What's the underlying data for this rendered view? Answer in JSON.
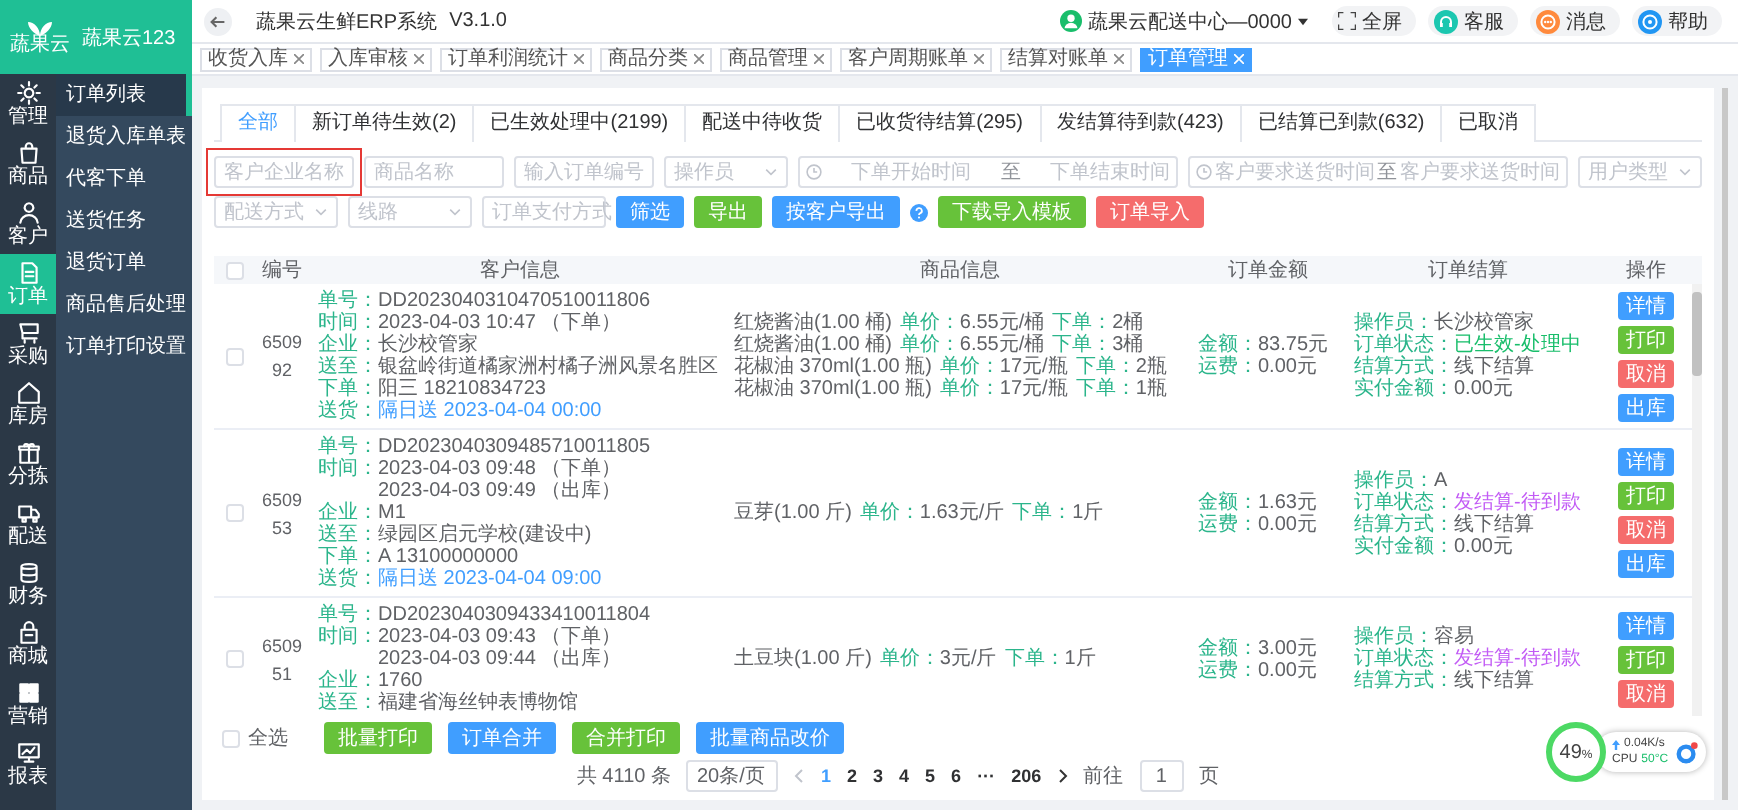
{
  "app": {
    "logo_text": "蔬果云",
    "brand": "蔬果云123"
  },
  "rail": [
    {
      "label": "管理",
      "selected": false
    },
    {
      "label": "商品",
      "selected": false
    },
    {
      "label": "客户",
      "selected": false
    },
    {
      "label": "订单",
      "selected": true
    },
    {
      "label": "采购",
      "selected": false
    },
    {
      "label": "库房",
      "selected": false
    },
    {
      "label": "分拣",
      "selected": false
    },
    {
      "label": "配送",
      "selected": false
    },
    {
      "label": "财务",
      "selected": false
    },
    {
      "label": "商城",
      "selected": false
    },
    {
      "label": "营销",
      "selected": false
    },
    {
      "label": "报表",
      "selected": false
    }
  ],
  "submenu": [
    {
      "label": "订单列表",
      "selected": true
    },
    {
      "label": "退货入库单表",
      "selected": false
    },
    {
      "label": "代客下单",
      "selected": false
    },
    {
      "label": "送货任务",
      "selected": false
    },
    {
      "label": "退货订单",
      "selected": false
    },
    {
      "label": "商品售后处理",
      "selected": false
    },
    {
      "label": "订单打印设置",
      "selected": false
    }
  ],
  "header": {
    "title": "蔬果云生鲜ERP系统",
    "version": "V3.1.0",
    "user": "蔬果云配送中心—0000",
    "buttons": [
      {
        "label": "全屏",
        "kind": "fullscreen"
      },
      {
        "label": "客服",
        "kind": "service"
      },
      {
        "label": "消息",
        "kind": "message"
      },
      {
        "label": "帮助",
        "kind": "help"
      }
    ]
  },
  "tags": [
    {
      "label": "收货入库",
      "selected": false
    },
    {
      "label": "入库审核",
      "selected": false
    },
    {
      "label": "订单利润统计",
      "selected": false
    },
    {
      "label": "商品分类",
      "selected": false
    },
    {
      "label": "商品管理",
      "selected": false
    },
    {
      "label": "客户周期账单",
      "selected": false
    },
    {
      "label": "结算对账单",
      "selected": false
    },
    {
      "label": "订单管理",
      "selected": true
    }
  ],
  "status_tabs": [
    {
      "label": "全部",
      "selected": true
    },
    {
      "label": "新订单待生效(2)",
      "selected": false
    },
    {
      "label": "已生效处理中(2199)",
      "selected": false
    },
    {
      "label": "配送中待收货",
      "selected": false
    },
    {
      "label": "已收货待结算(295)",
      "selected": false
    },
    {
      "label": "发结算待到款(423)",
      "selected": false
    },
    {
      "label": "已结算已到款(632)",
      "selected": false
    },
    {
      "label": "已取消",
      "selected": false
    }
  ],
  "filter_rows": [
    {
      "items": [
        {
          "kind": "input",
          "placeholder": "客户企业名称",
          "highlighted": true
        },
        {
          "kind": "input",
          "placeholder": "商品名称",
          "highlighted": false
        },
        {
          "kind": "input",
          "placeholder": "输入订单编号",
          "highlighted": false
        },
        {
          "kind": "select",
          "placeholder": "操作员"
        },
        {
          "kind": "daterange",
          "start": "下单开始时间",
          "separator": "至",
          "end": "下单结束时间"
        },
        {
          "kind": "daterange",
          "start": "客户要求送货时间",
          "separator": "至",
          "end": "客户要求送货时间"
        },
        {
          "kind": "select",
          "placeholder": "用户类型"
        }
      ]
    },
    {
      "items": [
        {
          "kind": "select",
          "placeholder": "配送方式"
        },
        {
          "kind": "select",
          "placeholder": "线路"
        },
        {
          "kind": "select",
          "placeholder": "订单支付方式"
        },
        {
          "kind": "primary",
          "label": "筛选"
        },
        {
          "kind": "success",
          "label": "导出"
        },
        {
          "kind": "primary",
          "label": "按客户导出"
        },
        {
          "kind": "help"
        },
        {
          "kind": "success",
          "label": "下载导入模板"
        },
        {
          "kind": "danger",
          "label": "订单导入"
        }
      ]
    }
  ],
  "table": {
    "header_checked": false,
    "columns": [
      "编号",
      "客户信息",
      "商品信息",
      "订单金额",
      "订单结算",
      "操作"
    ],
    "rows": [
      {
        "checked": false,
        "id": "650992",
        "customer": [
          {
            "kind": "field",
            "label": "单号：",
            "value": "DD2023040310470510011806"
          },
          {
            "kind": "field",
            "label": "时间：",
            "value": "2023-04-03 10:47 （下单）"
          },
          {
            "kind": "field",
            "label": "企业：",
            "value": "长沙校管家"
          },
          {
            "kind": "field",
            "label": "送至：",
            "value": "银盆岭街道橘家洲村橘子洲风景名胜区"
          },
          {
            "kind": "field",
            "label": "下单：",
            "value": "阳三 18210834723"
          },
          {
            "kind": "delivery",
            "label": "送货：",
            "value": "隔日送 2023-04-04 00:00"
          }
        ],
        "products": [
          {
            "name": "红烧酱油(1.00 桶)",
            "price_label": "单价：",
            "price": "6.55元/桶",
            "qty_label": "下单：",
            "qty": "2桶"
          },
          {
            "name": "红烧酱油(1.00 桶)",
            "price_label": "单价：",
            "price": "6.55元/桶",
            "qty_label": "下单：",
            "qty": "3桶"
          },
          {
            "name": "花椒油 370ml(1.00 瓶)",
            "price_label": "单价：",
            "price": "17元/瓶",
            "qty_label": "下单：",
            "qty": "2瓶"
          },
          {
            "name": "花椒油 370ml(1.00 瓶)",
            "price_label": "单价：",
            "price": "17元/瓶",
            "qty_label": "下单：",
            "qty": "1瓶"
          }
        ],
        "amount": [
          {
            "label": "金额：",
            "value": "83.75元"
          },
          {
            "label": "运费：",
            "value": "0.00元"
          }
        ],
        "settlement": [
          {
            "label": "操作员：",
            "value": "长沙校管家"
          },
          {
            "label": "订单状态：",
            "value": "已生效-处理中",
            "color": "#19be6b"
          },
          {
            "label": "结算方式：",
            "value": "线下结算"
          },
          {
            "label": "实付金额：",
            "value": "0.00元"
          }
        ],
        "actions": [
          {
            "label": "详情",
            "kind": "primary"
          },
          {
            "label": "打印",
            "kind": "success"
          },
          {
            "label": "取消",
            "kind": "danger"
          },
          {
            "label": "出库",
            "kind": "primary"
          }
        ]
      },
      {
        "checked": false,
        "id": "650953",
        "customer": [
          {
            "kind": "field",
            "label": "单号：",
            "value": "DD2023040309485710011805"
          },
          {
            "kind": "field",
            "label": "时间：",
            "value": "2023-04-03 09:48 （下单）"
          },
          {
            "kind": "continued",
            "value": "2023-04-03 09:49 （出库）"
          },
          {
            "kind": "field",
            "label": "企业：",
            "value": "M1"
          },
          {
            "kind": "field",
            "label": "送至：",
            "value": "绿园区启元学校(建设中)"
          },
          {
            "kind": "field",
            "label": "下单：",
            "value": "A 13100000000"
          },
          {
            "kind": "delivery",
            "label": "送货：",
            "value": "隔日送 2023-04-04 09:00"
          }
        ],
        "products": [
          {
            "name": "豆芽(1.00 斤)",
            "price_label": "单价：",
            "price": "1.63元/斤",
            "qty_label": "下单：",
            "qty": "1斤"
          }
        ],
        "amount": [
          {
            "label": "金额：",
            "value": "1.63元"
          },
          {
            "label": "运费：",
            "value": "0.00元"
          }
        ],
        "settlement": [
          {
            "label": "操作员：",
            "value": "A"
          },
          {
            "label": "订单状态：",
            "value": "发结算-待到款",
            "color": "#c25bf5"
          },
          {
            "label": "结算方式：",
            "value": "线下结算"
          },
          {
            "label": "实付金额：",
            "value": "0.00元"
          }
        ],
        "actions": [
          {
            "label": "详情",
            "kind": "primary"
          },
          {
            "label": "打印",
            "kind": "success"
          },
          {
            "label": "取消",
            "kind": "danger"
          },
          {
            "label": "出库",
            "kind": "primary"
          }
        ]
      },
      {
        "checked": false,
        "id": "650951",
        "customer": [
          {
            "kind": "field",
            "label": "单号：",
            "value": "DD2023040309433410011804"
          },
          {
            "kind": "field",
            "label": "时间：",
            "value": "2023-04-03 09:43 （下单）"
          },
          {
            "kind": "continued",
            "value": "2023-04-03 09:44 （出库）"
          },
          {
            "kind": "field",
            "label": "企业：",
            "value": "1760"
          },
          {
            "kind": "field",
            "label": "送至：",
            "value": "福建省海丝钟表博物馆"
          }
        ],
        "products": [
          {
            "name": "土豆块(1.00 斤)",
            "price_label": "单价：",
            "price": "3元/斤",
            "qty_label": "下单：",
            "qty": "1斤"
          }
        ],
        "amount": [
          {
            "label": "金额：",
            "value": "3.00元"
          },
          {
            "label": "运费：",
            "value": "0.00元"
          }
        ],
        "settlement": [
          {
            "label": "操作员：",
            "value": "容易"
          },
          {
            "label": "订单状态：",
            "value": "发结算-待到款",
            "color": "#c25bf5"
          },
          {
            "label": "结算方式：",
            "value": "线下结算"
          }
        ],
        "actions": [
          {
            "label": "详情",
            "kind": "primary"
          },
          {
            "label": "打印",
            "kind": "success"
          },
          {
            "label": "取消",
            "kind": "danger"
          }
        ]
      }
    ]
  },
  "footer": {
    "select_all": {
      "label": "全选",
      "checked": false
    },
    "buttons": [
      {
        "label": "批量打印",
        "kind": "success"
      },
      {
        "label": "订单合并",
        "kind": "primary"
      },
      {
        "label": "合并打印",
        "kind": "success"
      },
      {
        "label": "批量商品改价",
        "kind": "primary"
      }
    ]
  },
  "pagination": {
    "total": "共 4110 条",
    "page_size": "20条/页",
    "pages": [
      {
        "label": "1",
        "selected": true
      },
      {
        "label": "2",
        "selected": false
      },
      {
        "label": "3",
        "selected": false
      },
      {
        "label": "4",
        "selected": false
      },
      {
        "label": "5",
        "selected": false
      },
      {
        "label": "6",
        "selected": false
      },
      {
        "label": "···",
        "selected": false
      },
      {
        "label": "206",
        "selected": false
      }
    ],
    "goto_label": "前往",
    "goto_value": "1",
    "goto_unit": "页"
  },
  "monitor": {
    "percent": "49",
    "unit": "%",
    "speed": "0.04K/s",
    "cpu_label": "CPU",
    "cpu_temp": "50°C"
  }
}
